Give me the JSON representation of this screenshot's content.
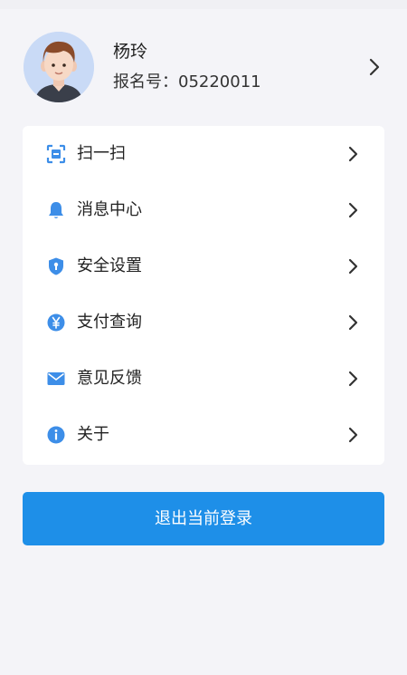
{
  "profile": {
    "name": "杨玲",
    "id_text": "报名号：05220011"
  },
  "menu": {
    "items": [
      {
        "label": "扫一扫",
        "icon": "scan-icon"
      },
      {
        "label": "消息中心",
        "icon": "bell-icon"
      },
      {
        "label": "安全设置",
        "icon": "shield-icon"
      },
      {
        "label": "支付查询",
        "icon": "yen-icon"
      },
      {
        "label": "意见反馈",
        "icon": "mail-icon"
      },
      {
        "label": "关于",
        "icon": "info-icon"
      }
    ]
  },
  "logout": {
    "label": "退出当前登录"
  },
  "colors": {
    "accent": "#1e8fe8",
    "icon": "#3d8ee8",
    "background": "#f4f4f8",
    "card": "#ffffff"
  }
}
